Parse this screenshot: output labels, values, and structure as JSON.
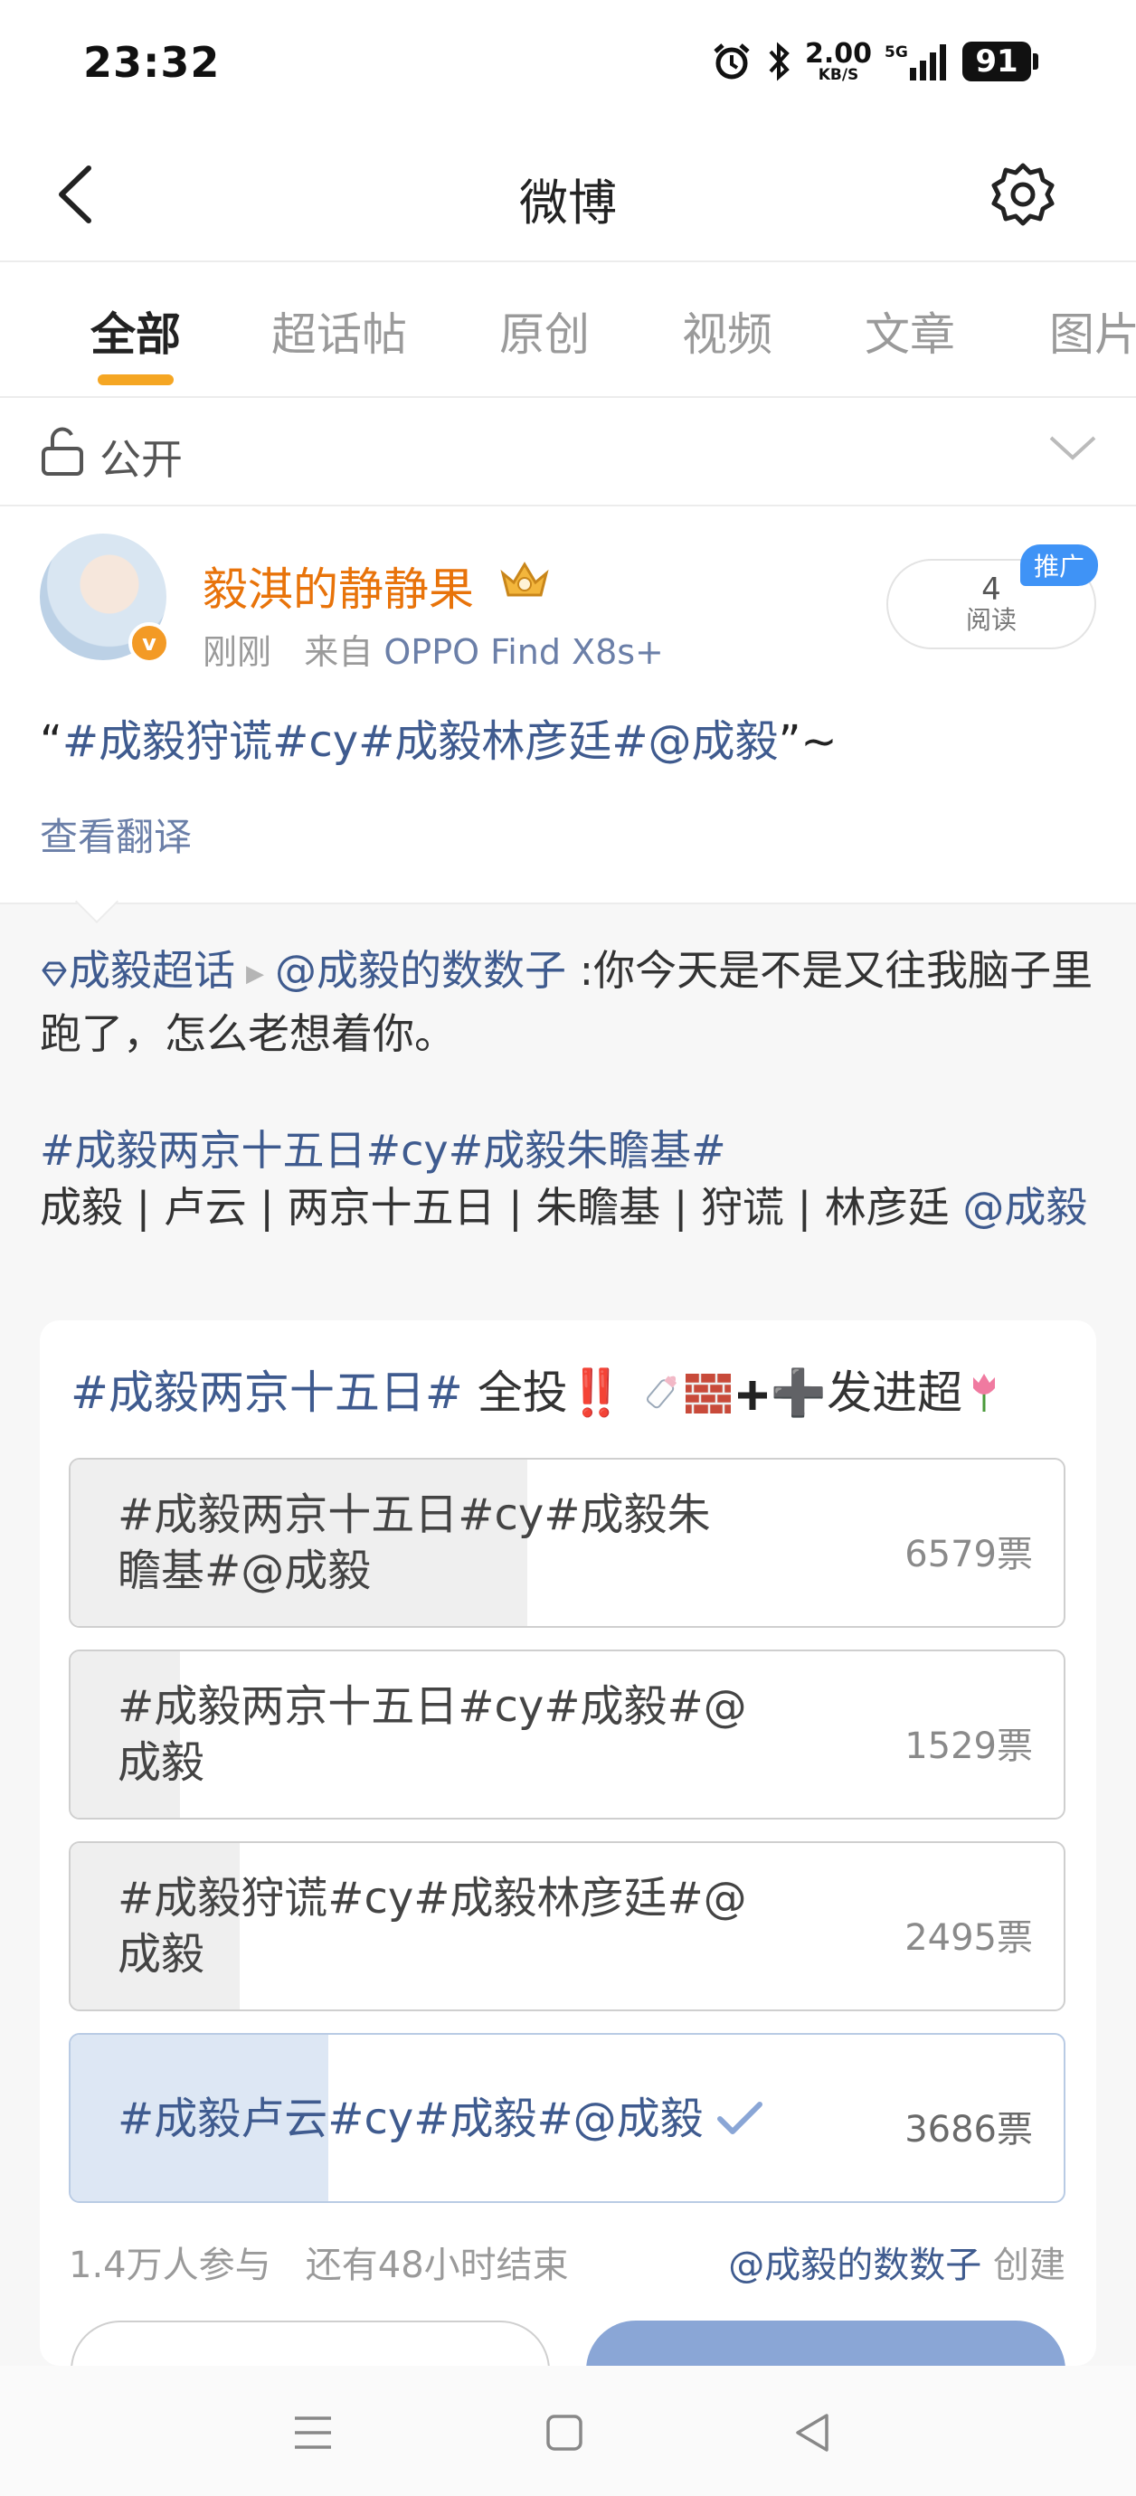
{
  "status": {
    "time": "23:32",
    "net_speed_value": "2.00",
    "net_speed_unit": "KB/S",
    "network": "5G",
    "battery": "91"
  },
  "header": {
    "title": "微博"
  },
  "tabs": [
    {
      "label": "全部",
      "active": true
    },
    {
      "label": "超话帖",
      "active": false
    },
    {
      "label": "原创",
      "active": false
    },
    {
      "label": "视频",
      "active": false
    },
    {
      "label": "文章",
      "active": false
    },
    {
      "label": "图片",
      "active": false
    }
  ],
  "visibility": {
    "label": "公开"
  },
  "post": {
    "author": "毅淇的静静果",
    "time": "刚刚",
    "source_prefix": "来自",
    "source": "OPPO Find X8s+",
    "reads": "4",
    "reads_label": "阅读",
    "promote_label": "推广",
    "text_open": "“",
    "text_tags": "#成毅狩谎#cy#成毅林彦廷#@成毅",
    "text_close": "”~",
    "translate_label": "查看翻译"
  },
  "repost": {
    "topic": "成毅超话",
    "author": "@成毅的数数子",
    "text": " :你今天是不是又往我脑子里跑了，怎么老想着你。",
    "tags_line": "#成毅两京十五日#cy#成毅朱瞻基#",
    "members_text": "成毅 | 卢云 | 两京十五日 | 朱瞻基 | 狩谎 | 林彦廷 ",
    "members_mention": "@成毅"
  },
  "poll": {
    "title_tag": "#成毅两京十五日#",
    "title_text": " 全投‼️",
    "title_after": "➕发进超",
    "options": [
      {
        "label_line1": "#成毅两京十五日#cy#成毅朱",
        "label_line2": "瞻基#@成毅",
        "votes": "6579票",
        "share": 0.46,
        "selected": false
      },
      {
        "label_line1": "#成毅两京十五日#cy#成毅#@",
        "label_line2": "成毅",
        "votes": "1529票",
        "share": 0.11,
        "selected": false
      },
      {
        "label_line1": "#成毅狩谎#cy#成毅林彦廷#@",
        "label_line2": "成毅",
        "votes": "2495票",
        "share": 0.17,
        "selected": false
      },
      {
        "label_line1": "#成毅卢云#cy#成毅#@成毅",
        "label_line2": "",
        "votes": "3686票",
        "share": 0.26,
        "selected": true
      }
    ],
    "participants": "1.4万人参与",
    "remaining": "还有48小时结束",
    "creator": "@成毅的数数子",
    "creator_suffix": "创建"
  },
  "colors": {
    "accent_orange": "#f5a623",
    "username_orange": "#e8730a",
    "link_blue": "#3f5b8f",
    "promote_blue": "#3f93f6"
  }
}
